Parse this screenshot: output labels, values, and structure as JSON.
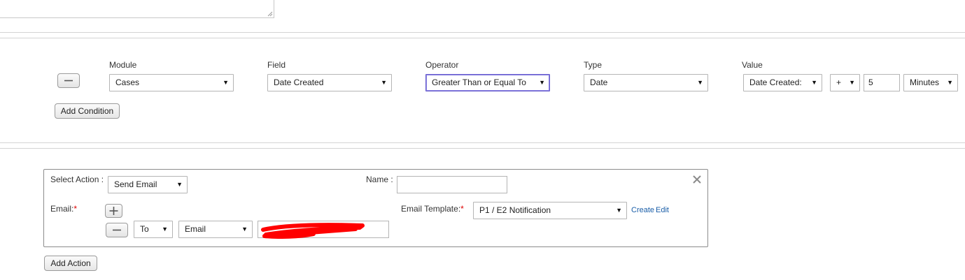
{
  "condition": {
    "headers": {
      "module": "Module",
      "field": "Field",
      "operator": "Operator",
      "type": "Type",
      "value": "Value"
    },
    "module_value": "Cases",
    "field_value": "Date Created",
    "operator_value": "Greater Than or Equal To",
    "type_value": "Date",
    "value_date_field": "Date Created:",
    "value_sign": "+",
    "value_amount": "5",
    "value_unit": "Minutes",
    "add_condition_label": "Add Condition"
  },
  "action": {
    "select_action_label": "Select Action :",
    "select_action_value": "Send Email",
    "name_label": "Name :",
    "name_value": "",
    "email_label": "Email:",
    "required_mark": "*",
    "email_template_label": "Email Template:",
    "email_template_value": "P1 / E2 Notification",
    "create_link": "Create",
    "edit_link": "Edit",
    "recipient_type": "To",
    "recipient_mode": "Email",
    "recipient_address": "",
    "add_action_label": "Add Action"
  },
  "icons": {
    "remove_condition": "minus-icon",
    "add_recipient": "plus-icon",
    "remove_recipient": "minus-icon",
    "close_action": "close-icon",
    "dropdown": "triangle-down-icon"
  },
  "colors": {
    "required": "#dd0000",
    "link": "#1a5ea8",
    "focus_border": "#6a5fcf",
    "redaction": "#ff0000"
  }
}
